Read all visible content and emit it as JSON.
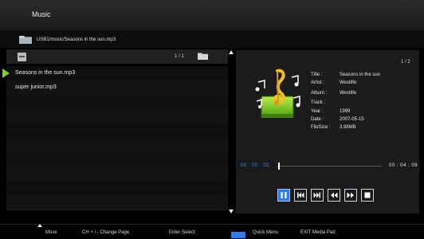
{
  "header": {
    "title": "Music"
  },
  "path": {
    "current": "USB1/music/Seasons in the sun.mp3",
    "icon": "folder-icon"
  },
  "list": {
    "page_info": "1 / 1",
    "items": [
      {
        "label": "Seasons in the sun.mp3",
        "playing": true
      },
      {
        "label": "super junior.mp3",
        "playing": false
      }
    ]
  },
  "info": {
    "page": "1 / 2",
    "fields": [
      {
        "label": "Title :",
        "value": "Seasons in the sun"
      },
      {
        "label": "Artist :",
        "value": "Westlife"
      },
      {
        "label": "Album :",
        "value": "Westlife"
      },
      {
        "label": "Track :",
        "value": ""
      },
      {
        "label": "Year :",
        "value": "1999"
      },
      {
        "label": "Date :",
        "value": "2007-05-15"
      },
      {
        "label": "FileSize :",
        "value": "3.98MB"
      }
    ]
  },
  "playback": {
    "current_time": "00 : 00 : 02",
    "total_time": "00 : 04 : 09",
    "progress": 0.008,
    "controls": [
      "pause-icon",
      "previous-track-icon",
      "next-track-icon",
      "rewind-icon",
      "fast-forward-icon",
      "stop-icon"
    ]
  },
  "footer": {
    "move": "Move",
    "change_page": "CH + / -  Change Page",
    "select": "Enter  Select",
    "quick_menu": "Quick Menu",
    "exit": "EXIT  Media Pad"
  },
  "colors": {
    "accent": "#2d7cf0",
    "playing_marker": "#7fd11b",
    "time_current": "#2f8cff"
  }
}
